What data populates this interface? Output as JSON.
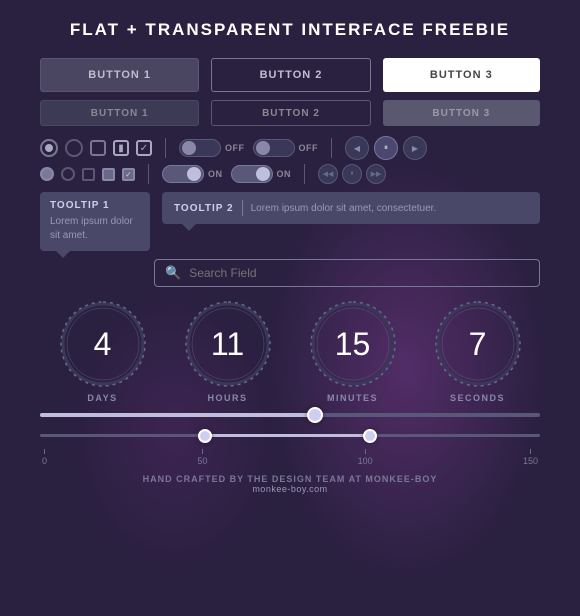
{
  "title": "FLAT + TRANSPARENT INTERFACE FREEBIE",
  "buttons": {
    "row1": [
      "BUTTON 1",
      "BUTTON 2",
      "BUTTON 3"
    ],
    "row2": [
      "BUTTON 1",
      "BUTTON 2",
      "BUTTON 3"
    ]
  },
  "toggles": {
    "items": [
      {
        "label": "OFF",
        "state": "off"
      },
      {
        "label": "OFF",
        "state": "off"
      },
      {
        "label": "ON",
        "state": "on"
      },
      {
        "label": "ON",
        "state": "on"
      }
    ]
  },
  "tooltip1": {
    "title": "TOOLTIP 1",
    "text": "Lorem ipsum dolor sit amet."
  },
  "tooltip2": {
    "title": "TOOLTIP 2",
    "text": "Lorem ipsum dolor sit amet, consectetuer."
  },
  "search": {
    "placeholder": "Search Field"
  },
  "timers": [
    {
      "value": "4",
      "label": "DAYS"
    },
    {
      "value": "11",
      "label": "HOURS"
    },
    {
      "value": "15",
      "label": "MINUTES"
    },
    {
      "value": "7",
      "label": "SECoNds"
    }
  ],
  "slider1": {
    "percent": 55
  },
  "range_slider": {
    "min": 0,
    "max": 150,
    "low": 50,
    "high": 100,
    "ticks": [
      "0",
      "50",
      "100",
      "150"
    ]
  },
  "footer": {
    "line1": "HAND CRAFTED BY THE DESIGN TEAM AT MONKEE-BOY",
    "line2": "monkee-boy.com"
  }
}
